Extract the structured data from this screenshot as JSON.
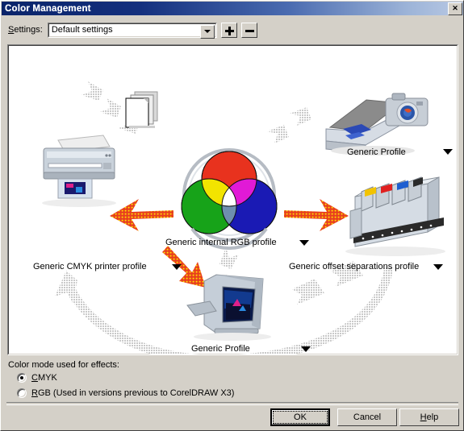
{
  "window": {
    "title": "Color Management",
    "close_label": "✕"
  },
  "settings": {
    "label_pre": "",
    "label_accel": "S",
    "label_post": "ettings:",
    "value": "Default settings",
    "add_label": "+",
    "remove_label": "−"
  },
  "diagram": {
    "nodes": [
      {
        "name": "documents",
        "label": ""
      },
      {
        "name": "scanner-camera",
        "label": "Generic Profile"
      },
      {
        "name": "rgb-internal",
        "label": "Generic internal RGB profile"
      },
      {
        "name": "cmyk-printer",
        "label": "Generic CMYK printer profile"
      },
      {
        "name": "offset-press",
        "label": "Generic offset separations profile"
      },
      {
        "name": "monitor",
        "label": "Generic Profile"
      }
    ],
    "arrow_colors": {
      "active": "#e8401f",
      "active_dots": "#ffe400",
      "inactive": "#c8c8c8"
    }
  },
  "color_mode": {
    "group_label": "Color mode used for effects:",
    "options": [
      {
        "accel": "C",
        "rest": "MYK",
        "pre": "",
        "checked": true
      },
      {
        "accel": "R",
        "rest": "GB (Used in versions previous to CorelDRAW X3)",
        "pre": "",
        "checked": false
      }
    ]
  },
  "footer": {
    "ok": "OK",
    "cancel": "Cancel",
    "help_accel": "H",
    "help_rest": "elp"
  }
}
